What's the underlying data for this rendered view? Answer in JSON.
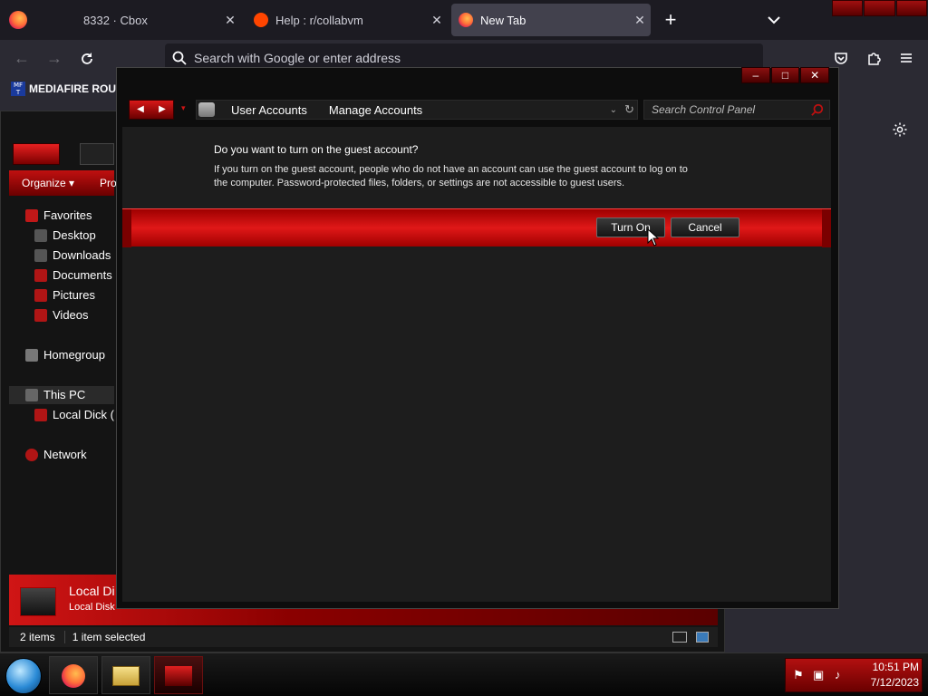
{
  "browser": {
    "tabs": [
      {
        "title": "8332 · Cbox",
        "active": false
      },
      {
        "title": "Help : r/collabvm",
        "active": false
      },
      {
        "title": "New Tab",
        "active": true
      }
    ],
    "address_placeholder": "Search with Google or enter address",
    "bookmark_label": "MEDIAFIRE ROULI",
    "bookmark_icon_text": "MF T"
  },
  "explorer": {
    "toolbar": {
      "organize": "Organize",
      "organize_arrow": "▾",
      "second": "Pro"
    },
    "nav": {
      "favorites": "Favorites",
      "desktop": "Desktop",
      "downloads": "Downloads",
      "documents": "Documents",
      "pictures": "Pictures",
      "videos": "Videos",
      "homegroup": "Homegroup",
      "this_pc": "This PC",
      "local_disk": "Local Dick (",
      "network": "Network"
    },
    "details": {
      "title": "Local Di",
      "subtitle": "Local Disk"
    },
    "status": {
      "items": "2 items",
      "selected": "1 item selected"
    }
  },
  "dialog": {
    "breadcrumb": [
      "User Accounts",
      "Manage Accounts"
    ],
    "search_placeholder": "Search Control Panel",
    "question": "Do you want to turn on the guest account?",
    "explanation_1": "If you turn on the guest account, people who do not have an account can use the guest account to log on to",
    "explanation_2": "the computer. Password-protected files, folders, or settings are not accessible to guest users.",
    "turn_on_label": "Turn On",
    "cancel_label": "Cancel"
  },
  "taskbar": {
    "time": "10:51 PM",
    "date": "7/12/2023"
  },
  "colors": {
    "accent_red": "#e01818",
    "dark_red": "#6a0000",
    "firefox_bg": "#1c1b22",
    "content_bg": "#1d1d1d"
  }
}
